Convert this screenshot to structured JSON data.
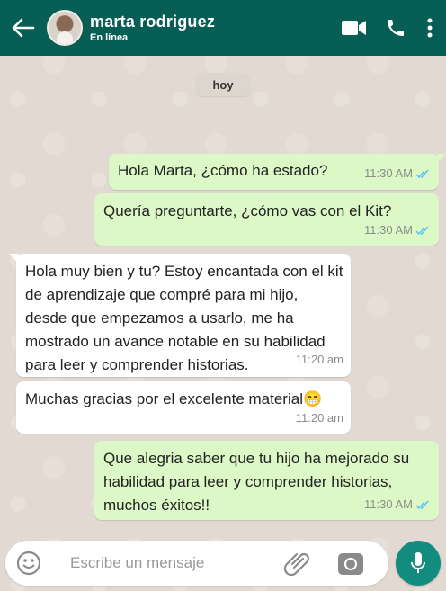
{
  "header": {
    "contact_name": "marta rodriguez",
    "status": "En línea",
    "icons": [
      "back-arrow-icon",
      "video-call-icon",
      "phone-icon",
      "more-options-icon"
    ],
    "color": "#075e54"
  },
  "date_chip": "hoy",
  "messages": [
    {
      "direction": "outgoing",
      "text": "Hola Marta, ¿cómo ha estado?",
      "time": "11:30 AM",
      "read": true
    },
    {
      "direction": "outgoing",
      "text": "Quería preguntarte, ¿cómo vas con el Kit?",
      "time": "11:30 AM",
      "read": true
    },
    {
      "direction": "incoming",
      "text": "Hola muy bien y tu? Estoy encantada con el kit de aprendizaje que compré para mi hijo, desde que empezamos a usarlo, me ha mostrado un avance notable en su habilidad para leer y comprender historias.",
      "time": "11:20 am"
    },
    {
      "direction": "incoming",
      "text": "Muchas gracias por el excelente material",
      "emoji": "😁",
      "time": "11:20 am"
    },
    {
      "direction": "outgoing",
      "text": "Que alegria saber que tu hijo ha mejorado su habilidad para leer y comprender historias, muchos éxitos!!",
      "time": "11:30 AM",
      "read": true
    }
  ],
  "composer": {
    "placeholder": "Escribe un mensaje",
    "icons": [
      "emoji-icon",
      "attach-icon",
      "camera-icon",
      "microphone-icon"
    ]
  },
  "colors": {
    "outgoing_bubble": "#dcf8c6",
    "incoming_bubble": "#ffffff",
    "read_ticks": "#4fc3f7",
    "mic_button": "#128c7e"
  }
}
